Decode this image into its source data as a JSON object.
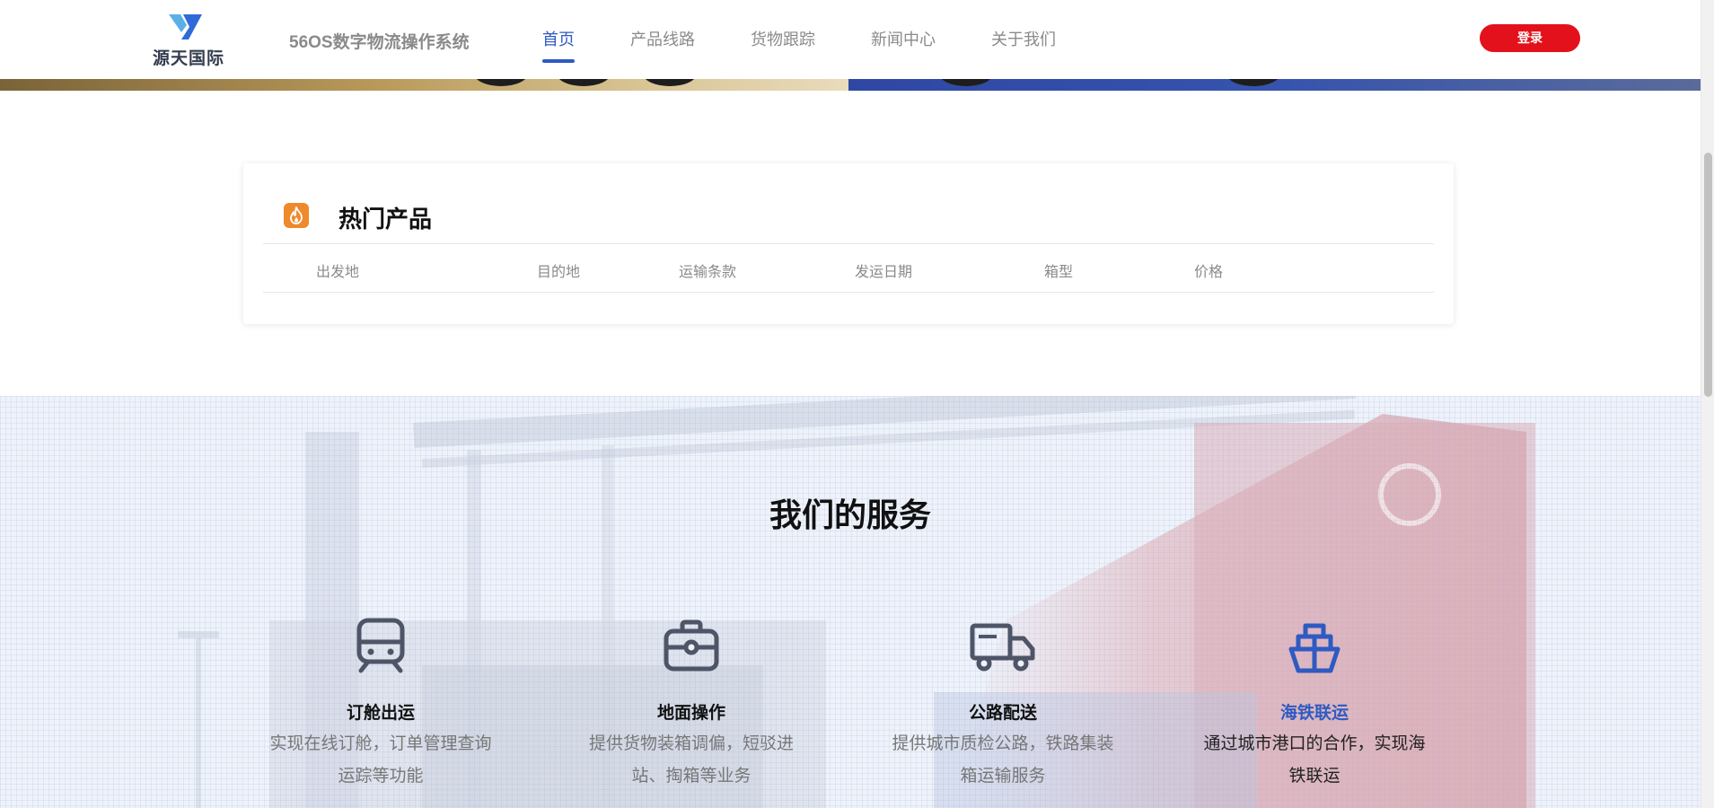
{
  "header": {
    "logo_text": "源天国际",
    "system_name": "56OS数字物流操作系统",
    "nav": [
      {
        "label": "首页",
        "active": true
      },
      {
        "label": "产品线路",
        "active": false
      },
      {
        "label": "货物跟踪",
        "active": false
      },
      {
        "label": "新闻中心",
        "active": false
      },
      {
        "label": "关于我们",
        "active": false
      }
    ],
    "login_label": "登录"
  },
  "hot_products": {
    "title": "热门产品",
    "columns": [
      "出发地",
      "目的地",
      "运输条款",
      "发运日期",
      "箱型",
      "价格"
    ],
    "rows": []
  },
  "services": {
    "title": "我们的服务",
    "items": [
      {
        "name": "订舱出运",
        "icon": "train-icon",
        "desc_line1": "实现在线订舱，订单管理查询",
        "desc_line2": "运踪等功能",
        "active": false
      },
      {
        "name": "地面操作",
        "icon": "briefcase-icon",
        "desc_line1": "提供货物装箱调偏，短驳进",
        "desc_line2": "站、掏箱等业务",
        "active": false
      },
      {
        "name": "公路配送",
        "icon": "truck-icon",
        "desc_line1": "提供城市质检公路，铁路集装",
        "desc_line2": "箱运输服务",
        "active": false
      },
      {
        "name": "海铁联运",
        "icon": "ship-icon",
        "desc_line1": "通过城市港口的合作，实现海",
        "desc_line2": "铁联运",
        "active": true
      }
    ]
  },
  "colors": {
    "accent": "#2f5ac2",
    "login": "#e3111b",
    "hot_icon": "#ee8a2c",
    "icon_gray": "#4e5566"
  }
}
